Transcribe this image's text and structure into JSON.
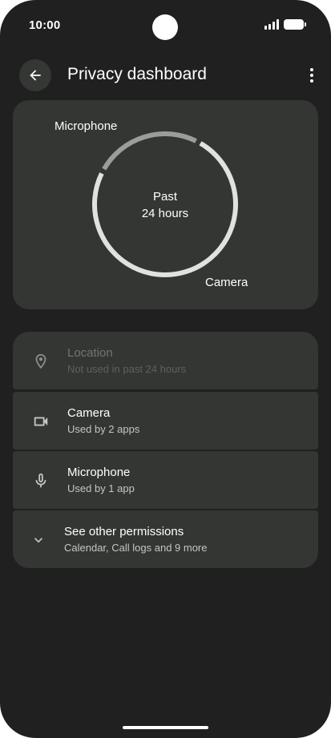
{
  "status_bar": {
    "time": "10:00",
    "icons": [
      "signal-icon",
      "battery-icon"
    ]
  },
  "header": {
    "title": "Privacy dashboard",
    "back_icon": "arrow-back-icon",
    "more_icon": "more-vert-icon"
  },
  "usage_chart": {
    "center_line1": "Past",
    "center_line2": "24 hours",
    "segments": [
      {
        "label": "Microphone",
        "share": 0.25,
        "color": "#9a9d99"
      },
      {
        "label": "Camera",
        "share": 0.75,
        "color": "#dfe3de"
      }
    ]
  },
  "permissions": [
    {
      "icon": "location-pin-icon",
      "title": "Location",
      "subtitle": "Not used in past 24 hours",
      "enabled": false
    },
    {
      "icon": "videocam-icon",
      "title": "Camera",
      "subtitle": "Used by 2 apps",
      "enabled": true
    },
    {
      "icon": "mic-icon",
      "title": "Microphone",
      "subtitle": "Used by 1 app",
      "enabled": true
    },
    {
      "icon": "chevron-down-icon",
      "title": "See other permissions",
      "subtitle": "Calendar, Call logs and 9 more",
      "enabled": true
    }
  ],
  "colors": {
    "background": "#1f201f",
    "surface": "#343634",
    "ring_primary": "#dfe3de",
    "ring_secondary": "#9a9d99"
  }
}
